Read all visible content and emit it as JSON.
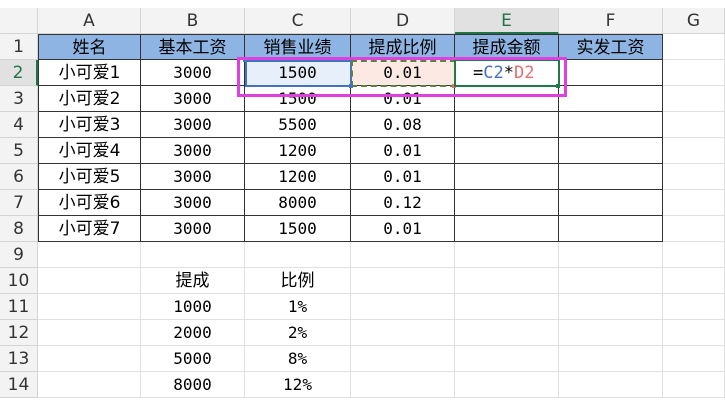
{
  "columns": [
    "A",
    "B",
    "C",
    "D",
    "E",
    "F",
    "G"
  ],
  "rows": [
    "1",
    "2",
    "3",
    "4",
    "5",
    "6",
    "7",
    "8",
    "9",
    "10",
    "11",
    "12",
    "13",
    "14"
  ],
  "selected_cell": "E2",
  "table": {
    "headers": [
      "姓名",
      "基本工资",
      "销售业绩",
      "提成比例",
      "提成金额",
      "实发工资"
    ],
    "records": [
      [
        "小可爱1",
        "3000",
        "1500",
        "0.01"
      ],
      [
        "小可爱2",
        "3000",
        "1500",
        "0.01"
      ],
      [
        "小可爱3",
        "3000",
        "5500",
        "0.08"
      ],
      [
        "小可爱4",
        "3000",
        "1200",
        "0.01"
      ],
      [
        "小可爱5",
        "3000",
        "1200",
        "0.01"
      ],
      [
        "小可爱6",
        "3000",
        "8000",
        "0.12"
      ],
      [
        "小可爱7",
        "3000",
        "1500",
        "0.01"
      ]
    ]
  },
  "formula": {
    "eq": "=",
    "ref1": "C2",
    "op": "*",
    "ref2": "D2"
  },
  "lookup": {
    "headers": [
      "提成",
      "比例"
    ],
    "rows": [
      [
        "1000",
        "1%"
      ],
      [
        "2000",
        "2%"
      ],
      [
        "5000",
        "8%"
      ],
      [
        "8000",
        "12%"
      ]
    ]
  },
  "colors": {
    "header_fill": "#8db4e2",
    "selection": "#1e7b48",
    "ref_c": "#4472c4",
    "ref_d": "#e07070",
    "annotation": "#e040e0"
  }
}
